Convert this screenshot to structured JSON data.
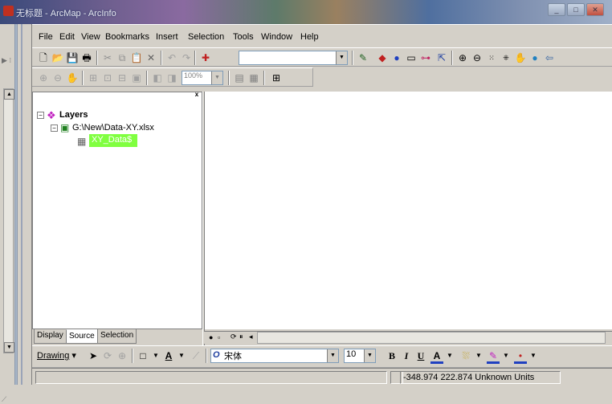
{
  "window": {
    "title": "无标题 - ArcMap - ArcInfo"
  },
  "menubar": {
    "items": [
      {
        "label": "File"
      },
      {
        "label": "Edit"
      },
      {
        "label": "View"
      },
      {
        "label": "Bookmarks"
      },
      {
        "label": "Insert"
      },
      {
        "label": "Selection"
      },
      {
        "label": "Tools"
      },
      {
        "label": "Window"
      },
      {
        "label": "Help"
      }
    ]
  },
  "standard_toolbar": {
    "scale_value": ""
  },
  "layout_toolbar": {
    "zoom_value": "100%"
  },
  "toc": {
    "root_label": "Layers",
    "workspace_label": "G:\\New\\Data-XY.xlsx",
    "table_label": "XY_Data$",
    "close_glyph": "x",
    "tabs": [
      "Display",
      "Source",
      "Selection"
    ]
  },
  "drawing_toolbar": {
    "label": "Drawing",
    "font_name": "宋体",
    "font_size": "10",
    "bold": "B",
    "italic": "I",
    "underline": "U",
    "font_color_glyph": "A",
    "text_tool_glyph": "A"
  },
  "statusbar": {
    "coordinates": "-348.974  222.874 Unknown Units"
  },
  "colors": {
    "selected_layer_bg": "#80ff40",
    "window_bg": "#d4d0c8"
  },
  "icons": [
    "new-icon",
    "open-icon",
    "save-icon",
    "print-icon",
    "cut-icon",
    "copy-icon",
    "paste-icon",
    "delete-icon",
    "undo-icon",
    "redo-icon",
    "add-data-icon",
    "editor-icon",
    "arctoolbox-icon",
    "identify-icon",
    "zoom-in-icon",
    "zoom-out-icon",
    "pan-icon",
    "globe-icon",
    "back-icon"
  ]
}
